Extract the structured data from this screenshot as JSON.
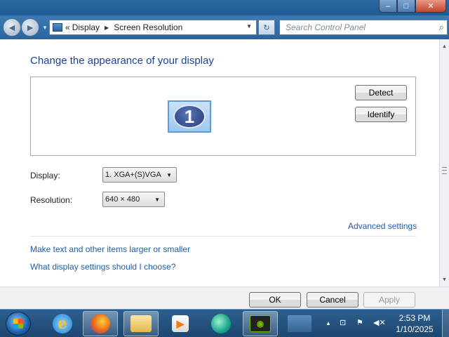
{
  "window": {
    "controls": {
      "minimize_icon": "minimize-icon",
      "maximize_icon": "maximize-icon",
      "close_icon": "close-icon"
    }
  },
  "navigation": {
    "back_icon": "back-arrow-icon",
    "forward_icon": "forward-arrow-icon",
    "address": {
      "overflow": "«",
      "crumbs": [
        "Display",
        "Screen Resolution"
      ]
    },
    "search": {
      "placeholder": "Search Control Panel"
    }
  },
  "main": {
    "title": "Change the appearance of your display",
    "monitor": {
      "number": "1"
    },
    "detect_label": "Detect",
    "identify_label": "Identify",
    "display_label": "Display:",
    "display_value": "1. XGA+(S)VGA",
    "resolution_label": "Resolution:",
    "resolution_value": "640 × 480",
    "advanced_link": "Advanced settings",
    "links": [
      "Make text and other items larger or smaller",
      "What display settings should I choose?"
    ]
  },
  "footer": {
    "ok_label": "OK",
    "cancel_label": "Cancel",
    "apply_label": "Apply"
  },
  "taskbar": {
    "items": [
      "start-orb",
      "internet-explorer-icon",
      "firefox-icon",
      "file-explorer-icon",
      "media-player-icon",
      "messenger-icon",
      "nvidia-icon",
      "display-icon"
    ],
    "tray": [
      "show-hidden-icons-icon",
      "network-icon",
      "action-center-flag-icon",
      "volume-muted-icon"
    ],
    "time": "2:53 PM",
    "date": "1/10/2025"
  },
  "colors": {
    "title_blue": "#1e3f91",
    "link_blue": "#1e5aa8",
    "taskbar": "#1d4670"
  }
}
